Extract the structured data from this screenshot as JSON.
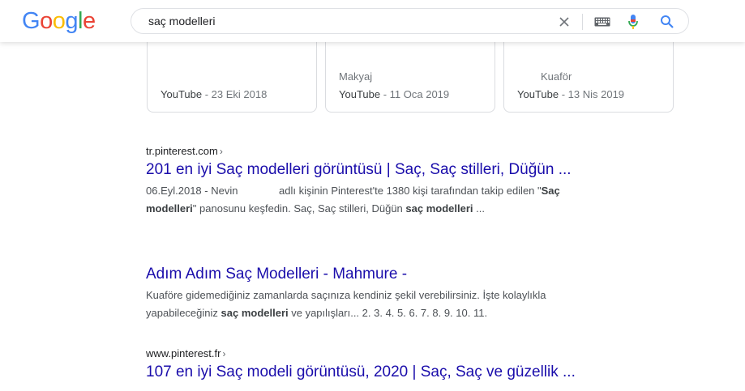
{
  "logo": {
    "letters": [
      "G",
      "o",
      "o",
      "g",
      "l",
      "e"
    ],
    "colors": [
      "#4285F4",
      "#EA4335",
      "#FBBC05",
      "#4285F4",
      "#34A853",
      "#EA4335"
    ]
  },
  "search": {
    "query": "saç modelleri"
  },
  "icons": {
    "clear": "close-icon",
    "keyboard": "keyboard-icon",
    "voice": "microphone-icon",
    "search": "search-icon"
  },
  "video_cards": [
    {
      "channel": "",
      "source": "YouTube",
      "sep": " - ",
      "date": "23 Eki 2018"
    },
    {
      "channel": "Makyaj",
      "source": "YouTube",
      "sep": " - ",
      "date": "11 Oca 2019"
    },
    {
      "channel": "Kuaför",
      "source": "YouTube",
      "sep": " - ",
      "date": "13 Nis 2019"
    }
  ],
  "results": [
    {
      "cite": "tr.pinterest.com",
      "arrow": "›",
      "title": "201 en iyi Saç modelleri görüntüsü | Saç, Saç stilleri, Düğün ...",
      "snippet_parts": [
        {
          "t": "06.Eyl.2018 - Nevin              adlı kişinin Pinterest'te 1380 kişi tarafından takip edilen \"",
          "b": false
        },
        {
          "t": "Saç",
          "b": true
        },
        {
          "t": "\n",
          "b": false
        },
        {
          "t": "modelleri",
          "b": true
        },
        {
          "t": "\" panosunu keşfedin. Saç, Saç stilleri, Düğün ",
          "b": false
        },
        {
          "t": "saç modelleri",
          "b": true
        },
        {
          "t": " ...",
          "b": false
        }
      ]
    },
    {
      "cite": "",
      "arrow": "",
      "title": "Adım Adım Saç Modelleri - Mahmure -",
      "snippet_parts": [
        {
          "t": "Kuaföre gidemediğiniz zamanlarda saçınıza kendiniz şekil verebilirsiniz. İşte kolaylıkla",
          "b": false
        },
        {
          "t": "\n",
          "b": false
        },
        {
          "t": "yapabileceğiniz ",
          "b": false
        },
        {
          "t": "saç modelleri",
          "b": true
        },
        {
          "t": " ve yapılışları... 2. 3. 4. 5. 6. 7. 8. 9. 10. 11.",
          "b": false
        }
      ]
    },
    {
      "cite": "www.pinterest.fr",
      "arrow": "›",
      "title": "107 en iyi Saç modeli görüntüsü, 2020 | Saç, Saç ve güzellik ...",
      "snippet_parts": []
    }
  ]
}
